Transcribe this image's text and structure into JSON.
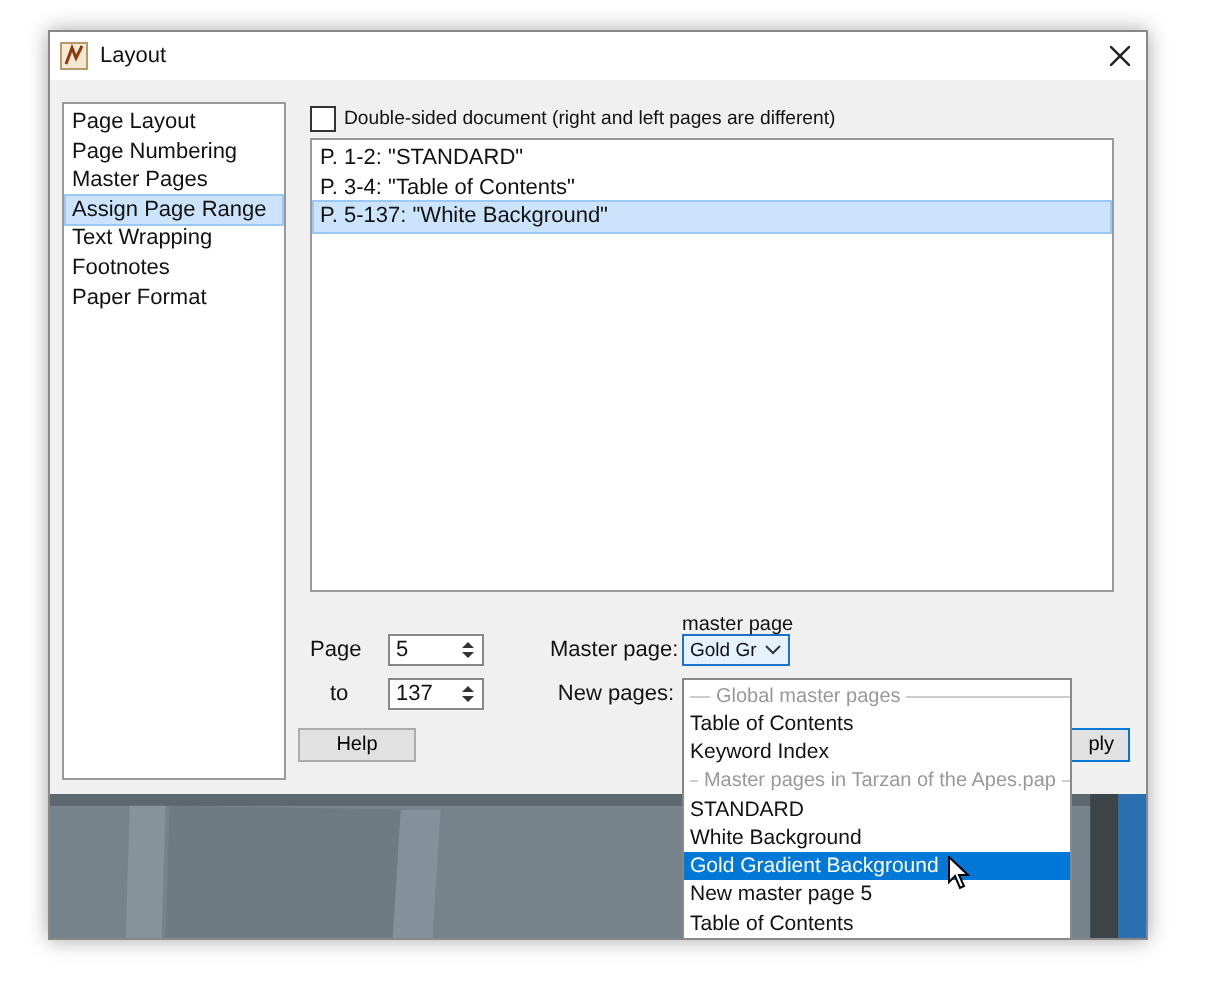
{
  "window": {
    "title": "Layout"
  },
  "sidebar": {
    "items": [
      {
        "label": "Page Layout",
        "selected": false
      },
      {
        "label": "Page Numbering",
        "selected": false
      },
      {
        "label": "Master Pages",
        "selected": false
      },
      {
        "label": "Assign Page Range",
        "selected": true
      },
      {
        "label": "Text Wrapping",
        "selected": false
      },
      {
        "label": "Footnotes",
        "selected": false
      },
      {
        "label": "Paper Format",
        "selected": false
      }
    ]
  },
  "double_sided": {
    "label": "Double-sided document (right and left pages are different)",
    "checked": false
  },
  "ranges": [
    {
      "label": "P. 1-2: \"STANDARD\"",
      "selected": false
    },
    {
      "label": "P. 3-4: \"Table of Contents\"",
      "selected": false
    },
    {
      "label": "P. 5-137: \"White Background\"",
      "selected": true
    }
  ],
  "page_from": {
    "label": "Page",
    "value": "5"
  },
  "page_to": {
    "label": "to",
    "value": "137"
  },
  "master_page": {
    "label": "Master page:",
    "value": "Gold Gr",
    "tooltip": "master page"
  },
  "new_pages": {
    "label": "New pages:"
  },
  "buttons": {
    "help": "Help",
    "apply": "ply"
  },
  "dropdown": [
    {
      "kind": "header",
      "label": "Global master pages"
    },
    {
      "kind": "item",
      "label": "Table of Contents",
      "selected": false
    },
    {
      "kind": "item",
      "label": "Keyword Index",
      "selected": false
    },
    {
      "kind": "header",
      "label": "Master pages in Tarzan of the Apes.pap"
    },
    {
      "kind": "item",
      "label": "STANDARD",
      "selected": false
    },
    {
      "kind": "item",
      "label": "White Background",
      "selected": false
    },
    {
      "kind": "item",
      "label": "Gold Gradient Background",
      "selected": true
    },
    {
      "kind": "item",
      "label": "New master page 5",
      "selected": false
    },
    {
      "kind": "item",
      "label": "Table of Contents",
      "selected": false
    }
  ]
}
